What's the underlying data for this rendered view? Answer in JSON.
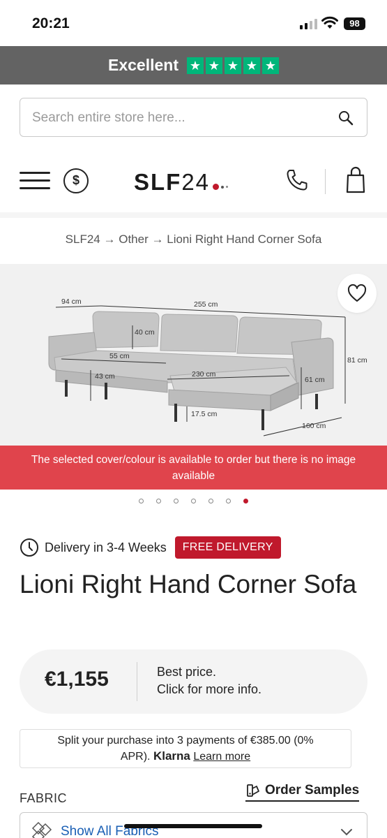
{
  "status_bar": {
    "time": "20:21",
    "battery": "98"
  },
  "trustbar": {
    "label": "Excellent",
    "star_glyph": "★",
    "rating": 5,
    "accent": "#00b67a"
  },
  "search": {
    "placeholder": "Search entire store here..."
  },
  "header": {
    "logo_text": "SLF",
    "logo_num": "24",
    "brand_color": "#c0192c"
  },
  "breadcrumb": {
    "items": [
      "SLF24",
      "Other",
      "Lioni Right Hand Corner Sofa"
    ],
    "separator": "→"
  },
  "product_image": {
    "dimensions": [
      "94 cm",
      "255 cm",
      "40 cm",
      "55 cm",
      "43 cm",
      "230 cm",
      "81 cm",
      "61 cm",
      "17.5 cm",
      "160 cm"
    ],
    "alert": "The selected cover/colour is available to order but there is no image available",
    "carousel_count": 7,
    "carousel_active": 7
  },
  "delivery": {
    "text": "Delivery in 3-4 Weeks",
    "badge": "FREE DELIVERY"
  },
  "product": {
    "title": "Lioni Right Hand Corner Sofa"
  },
  "pricing": {
    "price": "€1,155",
    "best_line1": "Best price.",
    "best_line2": "Click for more info."
  },
  "klarna": {
    "line1": "Split your purchase into 3 payments of €385.00 (0%",
    "line2_prefix": "APR).",
    "brand": "Klarna",
    "link": "Learn more"
  },
  "fabric": {
    "label": "FABRIC",
    "order_samples": "Order Samples",
    "select_text": "Show All Fabrics"
  }
}
